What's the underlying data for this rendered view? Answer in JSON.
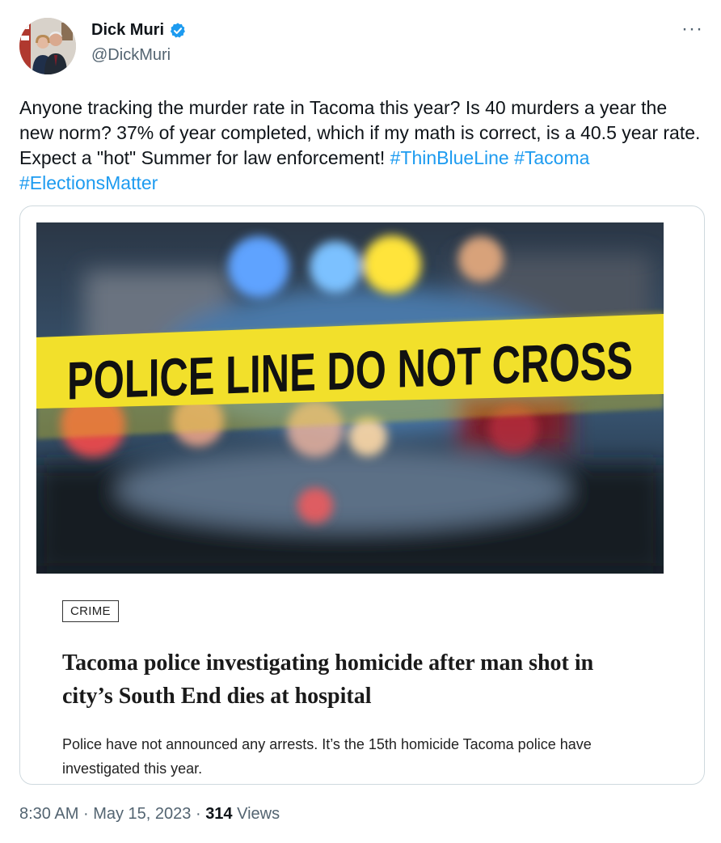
{
  "author": {
    "name": "Dick Muri",
    "handle": "@DickMuri",
    "verified": true,
    "avatar_icon": "profile-photo"
  },
  "menu": {
    "more_label": "···"
  },
  "tweet": {
    "text": "Anyone tracking the murder rate in Tacoma this year?  Is 40 murders a year the new norm?  37% of year completed, which if my math is correct, is a 40.5 year rate. Expect a \"hot\" Summer for law enforcement!  ",
    "hashtags": [
      "#ThinBlueLine",
      "#Tacoma",
      "#ElectionsMatter"
    ]
  },
  "card": {
    "image_banner_text": "POLICE LINE DO NOT CROSS",
    "category": "CRIME",
    "headline": "Tacoma police investigating homicide after man shot in city’s South End dies at hospital",
    "summary": "Police have not announced any arrests. It’s the 15th homicide Tacoma police have investigated this year."
  },
  "meta": {
    "time": "8:30 AM",
    "separator": "·",
    "date": "May 15, 2023",
    "views_count": "314",
    "views_label": "Views"
  },
  "colors": {
    "link": "#1d9bf0",
    "secondary_text": "#536471",
    "border": "#cfd9de",
    "tape": "#f2e02b"
  }
}
